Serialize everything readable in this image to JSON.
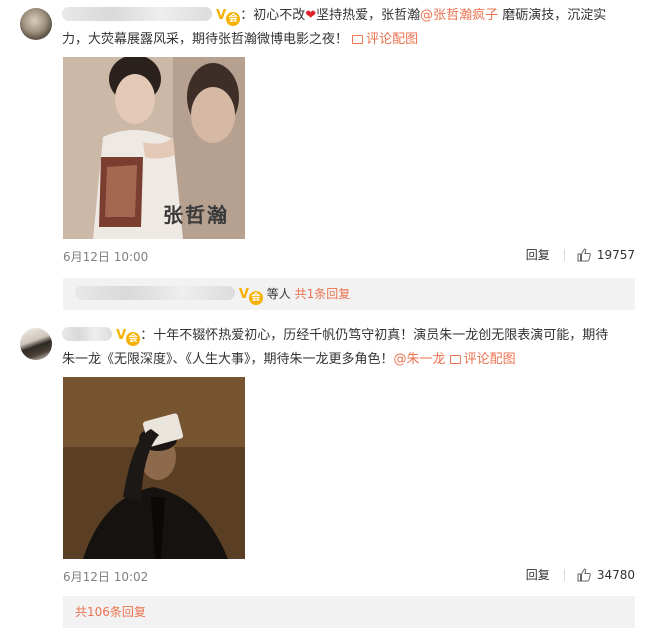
{
  "comments": [
    {
      "text_line1_a": "：初心不改",
      "heart": "❤",
      "text_line1_b": "坚持热爱，张哲瀚",
      "mention": "@张哲瀚疯子",
      "text_line1_c": " 磨砺演技，沉淀实",
      "text_line2": "力，大荧幕展露风采，期待张哲瀚微博电影之夜！",
      "pic_link": "评论配图",
      "photo_caption": "张哲瀚",
      "date": "6月12日 10:00",
      "reply_label": "回复",
      "like_count": "19757",
      "sub_text": "等人",
      "sub_link": "共1条回复"
    },
    {
      "text_line1": "：十年不辍怀热爱初心，历经千帆仍笃守初真！演员朱一龙创无限表演可能，期待",
      "text_line2": "朱一龙《无限深度》、《人生大事》，期待朱一龙更多角色！",
      "mention": "@朱一龙",
      "pic_link": "评论配图",
      "date": "6月12日 10:02",
      "reply_label": "回复",
      "like_count": "34780"
    }
  ],
  "more_replies": "共106条回复",
  "colors": {
    "link": "#eb7350",
    "vip": "#f6b100",
    "heart": "#e0242b",
    "box": "#f2f2f2"
  },
  "icons": [
    "vip-badge-icon",
    "heart-icon",
    "picture-icon",
    "thumbs-up-icon"
  ]
}
